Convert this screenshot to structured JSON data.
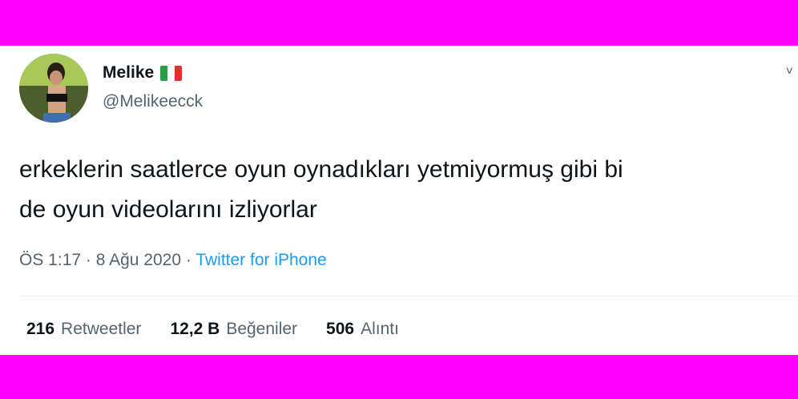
{
  "user": {
    "name": "Melike",
    "flag_emoji": "🇮🇹",
    "handle": "@Melikeecck"
  },
  "menu_glyph": "˅",
  "tweet": {
    "text": "erkeklerin saatlerce oyun oynadıkları yetmiyormuş gibi bi\nde oyun videolarını izliyorlar",
    "time": "ÖS 1:17",
    "separator": " · ",
    "date": "8 Ağu 2020",
    "source": "Twitter for iPhone"
  },
  "stats": {
    "retweets": {
      "count": "216",
      "label": "Retweetler"
    },
    "likes": {
      "count": "12,2 B",
      "label": "Beğeniler"
    },
    "quotes": {
      "count": "506",
      "label": "Alıntı"
    }
  },
  "colors": {
    "background_frame": "#ff00ff",
    "link": "#1d9bf0",
    "secondary_text": "#536471"
  }
}
